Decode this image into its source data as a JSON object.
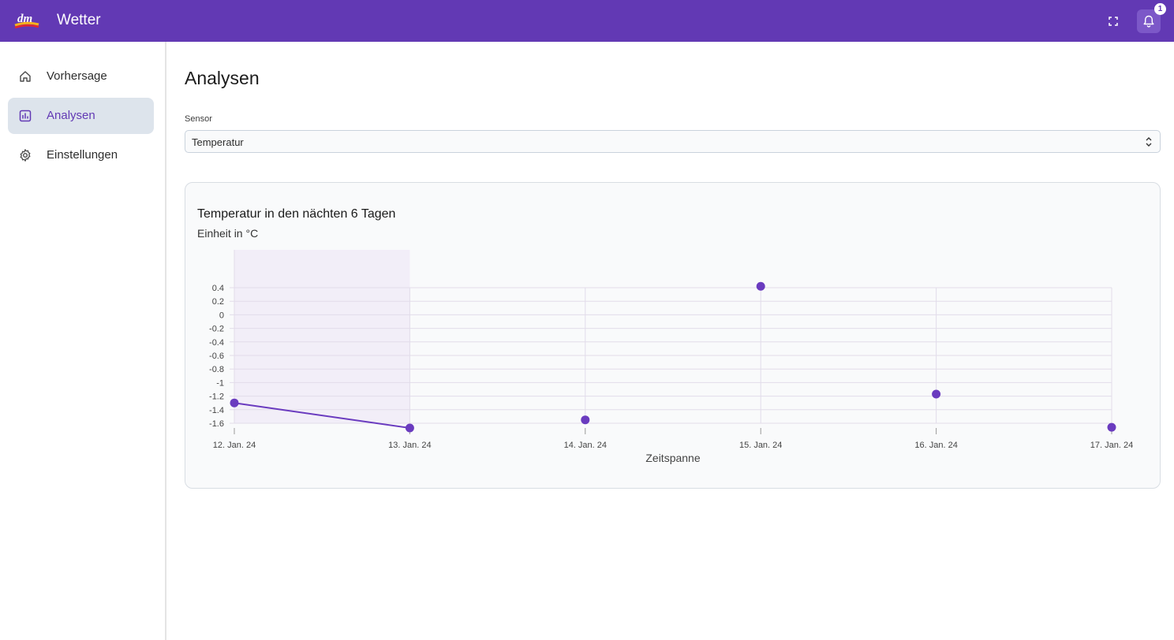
{
  "header": {
    "logo_text": "dm",
    "app_title": "Wetter",
    "fullscreen_icon": "fullscreen-icon",
    "bell_icon": "bell-icon",
    "notification_count": "1"
  },
  "sidebar": {
    "items": [
      {
        "label": "Vorhersage",
        "icon": "home-icon",
        "active": false
      },
      {
        "label": "Analysen",
        "icon": "chart-icon",
        "active": true
      },
      {
        "label": "Einstellungen",
        "icon": "gear-icon",
        "active": false
      }
    ]
  },
  "main": {
    "title": "Analysen",
    "sensor": {
      "label": "Sensor",
      "value": "Temperatur"
    }
  },
  "colors": {
    "brand": "#6239b4",
    "active_bg": "#dde4ec",
    "point": "#6a3bbf"
  },
  "chart_data": {
    "type": "scatter",
    "title": "Temperatur in den nächten 6 Tagen",
    "subtitle": "Einheit in °C",
    "xlabel": "Zeitspanne",
    "ylabel": "",
    "x": [
      "12. Jan. 24",
      "13. Jan. 24",
      "14. Jan. 24",
      "15. Jan. 24",
      "16. Jan. 24",
      "17. Jan. 24"
    ],
    "values": [
      -1.3,
      -1.67,
      -1.55,
      0.42,
      -1.17,
      -1.66
    ],
    "connected_segment": [
      0,
      1
    ],
    "yticks": [
      0.4,
      0.2,
      0,
      -0.2,
      -0.4,
      -0.6,
      -0.8,
      -1,
      -1.2,
      -1.4,
      -1.6
    ],
    "ytick_labels": [
      "0.4",
      "0.2",
      "0",
      "-0.2",
      "-0.4",
      "-0.6",
      "-0.8",
      "-1",
      "-1.2",
      "-1.4",
      "-1.6"
    ],
    "ylim": [
      -1.6,
      0.4
    ],
    "grid": true,
    "highlighted_range": [
      "12. Jan. 24",
      "13. Jan. 24"
    ]
  }
}
